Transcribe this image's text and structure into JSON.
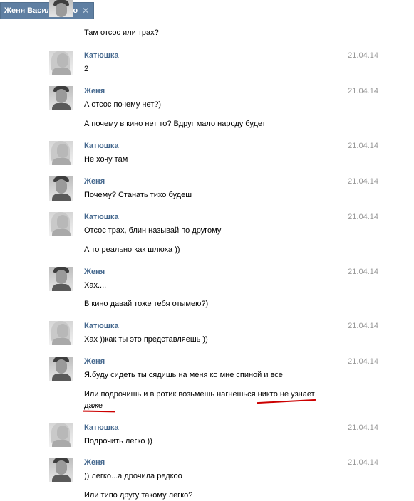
{
  "tab": {
    "title": "Женя Васильченко",
    "close_icon": "close-icon"
  },
  "messages": [
    {
      "author_type": "jenya",
      "author": "",
      "date": "",
      "lines": [
        "Там отсос или трах?"
      ]
    },
    {
      "author_type": "katya",
      "author": "Катюшка",
      "date": "21.04.14",
      "lines": [
        "2"
      ]
    },
    {
      "author_type": "jenya",
      "author": "Женя",
      "date": "21.04.14",
      "lines": [
        "А отсос почему нет?)",
        "А почему в кино нет то? Вдруг мало народу будет"
      ]
    },
    {
      "author_type": "katya",
      "author": "Катюшка",
      "date": "21.04.14",
      "lines": [
        "Не хочу там"
      ]
    },
    {
      "author_type": "jenya",
      "author": "Женя",
      "date": "21.04.14",
      "lines": [
        "Почему? Станать тихо будеш"
      ]
    },
    {
      "author_type": "katya",
      "author": "Катюшка",
      "date": "21.04.14",
      "lines": [
        "Отсос трах, блин называй по другому",
        "А то реально как шлюха ))"
      ]
    },
    {
      "author_type": "jenya",
      "author": "Женя",
      "date": "21.04.14",
      "lines": [
        "Хах....",
        "В кино давай тоже тебя отымею?)"
      ]
    },
    {
      "author_type": "katya",
      "author": "Катюшка",
      "date": "21.04.14",
      "lines": [
        "Хах ))как ты это представляешь ))"
      ]
    },
    {
      "author_type": "jenya",
      "author": "Женя",
      "date": "21.04.14",
      "lines": [
        "Я.буду сидеть ты сядишь на меня ко мне спиной и все",
        "Или подрочишь и в ротик возьмешь нагнешься никто не узнает",
        "даже"
      ]
    },
    {
      "author_type": "katya",
      "author": "Катюшка",
      "date": "21.04.14",
      "lines": [
        "Подрочить легко ))"
      ]
    },
    {
      "author_type": "jenya",
      "author": "Женя",
      "date": "21.04.14",
      "lines": [
        ")) легко...а дрочила редкоо",
        "Или типо другу такому легко?"
      ]
    }
  ]
}
